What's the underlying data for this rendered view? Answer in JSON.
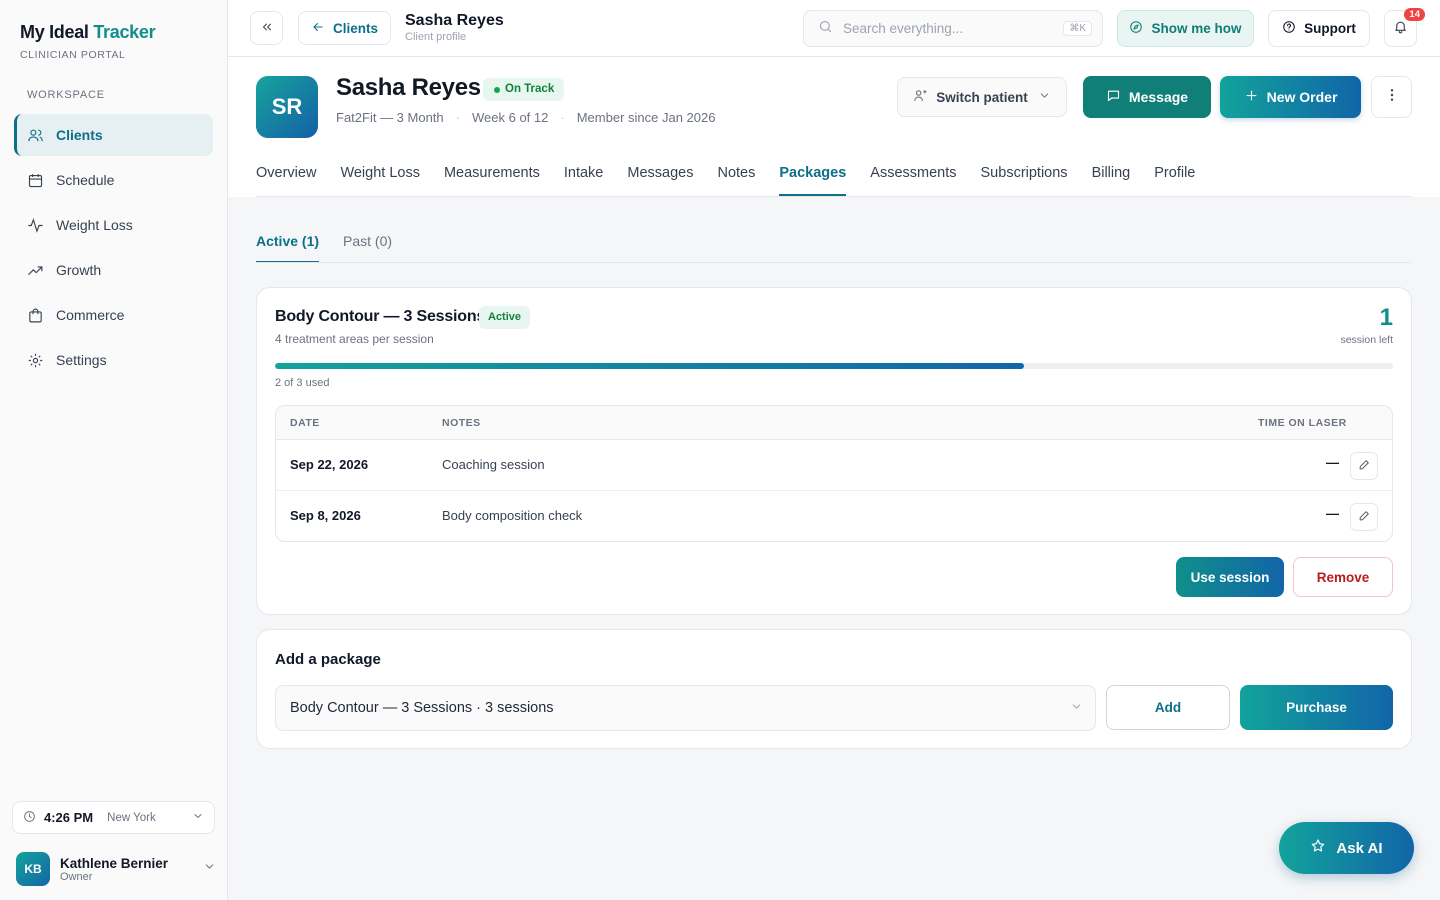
{
  "app": {
    "brand_main": "My Ideal",
    "brand_accent": "Tracker",
    "brand_sub": "CLINICIAN PORTAL",
    "workspace_label": "WORKSPACE",
    "accent_color": "#0d6f8a",
    "brand_color": "#0f8f8a"
  },
  "sidebar": {
    "items": [
      {
        "label": "Clients",
        "icon": "users-icon",
        "active": true
      },
      {
        "label": "Schedule",
        "icon": "calendar-icon"
      },
      {
        "label": "Weight Loss",
        "icon": "activity-icon"
      },
      {
        "label": "Growth",
        "icon": "trending-up-icon"
      },
      {
        "label": "Commerce",
        "icon": "shopping-bag-icon"
      },
      {
        "label": "Settings",
        "icon": "gear-icon"
      }
    ],
    "clock": {
      "time": "4:26 PM",
      "city": "New York"
    },
    "user": {
      "initials": "KB",
      "name": "Kathlene Bernier",
      "role": "Owner"
    }
  },
  "topbar": {
    "back_label": "Clients",
    "title": "Sasha Reyes",
    "subtitle": "Client profile",
    "search_placeholder": "Search everything...",
    "search_shortcut": "⌘K",
    "show_me_how": "Show me how",
    "support": "Support",
    "notifications_count": "14"
  },
  "profile": {
    "initials": "SR",
    "name": "Sasha Reyes",
    "status": "On Track",
    "program": "Fat2Fit — 3 Month",
    "week": "Week 6 of 12",
    "member_since": "Member since Jan 2026",
    "switch_patient": "Switch patient",
    "message": "Message",
    "new_order": "New Order",
    "tabs": [
      "Overview",
      "Weight Loss",
      "Measurements",
      "Intake",
      "Messages",
      "Notes",
      "Packages",
      "Assessments",
      "Subscriptions",
      "Billing",
      "Profile"
    ],
    "active_tab": "Packages"
  },
  "packages": {
    "subtabs": [
      "Active (1)",
      "Past (0)"
    ],
    "active_package": {
      "title": "Body Contour — 3 Sessions",
      "status": "Active",
      "subtitle": "4 treatment areas per session",
      "sessions_left": "1",
      "sessions_left_label": "session left",
      "progress_fraction": 0.67,
      "used_text": "2 of 3 used",
      "columns": [
        "DATE",
        "NOTES",
        "TIME ON LASER"
      ],
      "rows": [
        {
          "date": "Sep 22, 2026",
          "notes": "Coaching session",
          "time": "—"
        },
        {
          "date": "Sep 8, 2026",
          "notes": "Body composition check",
          "time": "—"
        }
      ],
      "use_session": "Use session",
      "remove": "Remove"
    },
    "add": {
      "title": "Add a package",
      "selected": "Body Contour — 3 Sessions · 3 sessions",
      "add": "Add",
      "purchase": "Purchase"
    }
  },
  "ask_ai": "Ask AI"
}
